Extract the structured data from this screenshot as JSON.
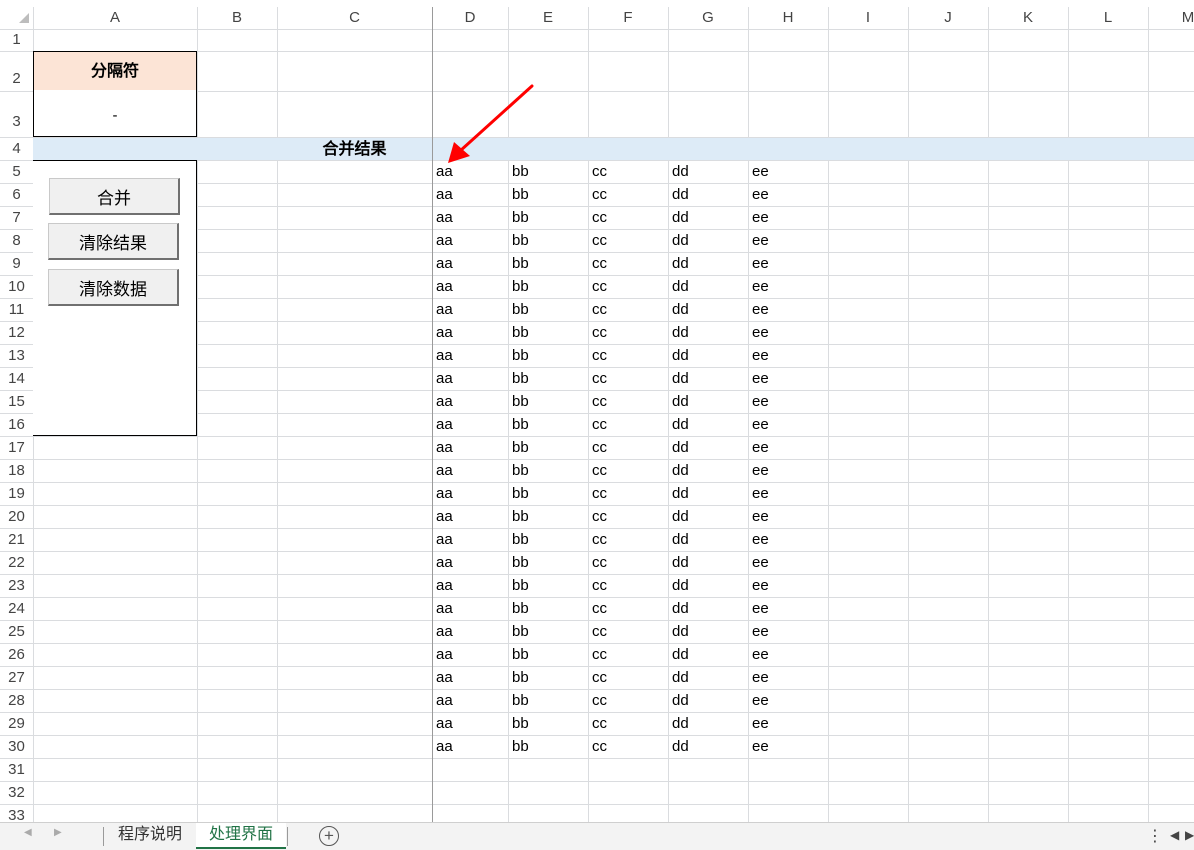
{
  "sheet": {
    "columns": [
      "A",
      "B",
      "C",
      "D",
      "E",
      "F",
      "G",
      "H",
      "I",
      "J",
      "K",
      "L",
      "M"
    ],
    "rows": [
      "1",
      "2",
      "3",
      "4",
      "5",
      "6",
      "7",
      "8",
      "9",
      "10",
      "11",
      "12",
      "13",
      "14",
      "15",
      "16",
      "17",
      "18",
      "19",
      "20",
      "21",
      "22",
      "23",
      "24",
      "25",
      "26",
      "27",
      "28",
      "29",
      "30",
      "31",
      "32",
      "33"
    ],
    "separator_label": "分隔符",
    "separator_value": "-",
    "merge_header": "合并结果",
    "data_values": [
      "aa",
      "bb",
      "cc",
      "dd",
      "ee"
    ],
    "data_row_count": 26
  },
  "buttons": {
    "merge": "合并",
    "clear_result": "清除结果",
    "clear_data": "清除数据"
  },
  "tabs": {
    "items": [
      "程序说明",
      "处理界面"
    ],
    "active": "处理界面"
  },
  "icons": {
    "nav_prev": "◀",
    "nav_next": "▶",
    "add_sheet": "+",
    "more": "⋮",
    "scroll_left": "◀",
    "scroll_right": "▶"
  },
  "colors": {
    "separator_header_bg": "#fce4d6",
    "merge_header_bg": "#ddebf7",
    "annotation_arrow": "#ff0000",
    "active_tab_text": "#217346"
  }
}
